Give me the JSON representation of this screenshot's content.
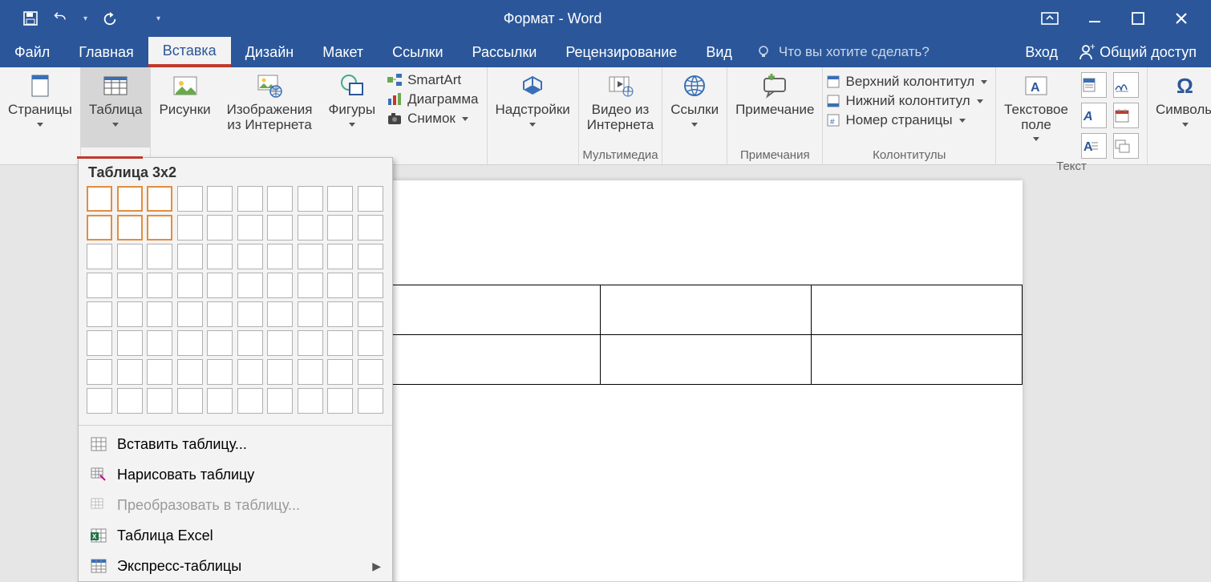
{
  "titlebar": {
    "title": "Формат - Word"
  },
  "tabs": {
    "items": [
      "Файл",
      "Главная",
      "Вставка",
      "Дизайн",
      "Макет",
      "Ссылки",
      "Рассылки",
      "Рецензирование",
      "Вид"
    ],
    "active_index": 2,
    "tellme_placeholder": "Что вы хотите сделать?",
    "signin": "Вход",
    "share": "Общий доступ"
  },
  "ribbon": {
    "pages": {
      "label": "Страницы"
    },
    "table": {
      "label": "Таблица"
    },
    "pics": {
      "label": "Рисунки"
    },
    "netpics": {
      "label": "Изображения из Интернета"
    },
    "shapes": {
      "label": "Фигуры"
    },
    "smartart": "SmartArt",
    "chart": "Диаграмма",
    "screenshot": "Снимок",
    "addins": {
      "label": "Надстройки"
    },
    "video": {
      "label": "Видео из Интернета",
      "caption": "Мультимедиа"
    },
    "links": {
      "label": "Ссылки"
    },
    "comment": {
      "label": "Примечание",
      "caption": "Примечания"
    },
    "header": "Верхний колонтитул",
    "footer": "Нижний колонтитул",
    "pagenum": "Номер страницы",
    "hf_caption": "Колонтитулы",
    "textbox": {
      "label": "Текстовое поле"
    },
    "text_caption": "Текст",
    "symbols": {
      "label": "Символы"
    }
  },
  "menu": {
    "title": "Таблица 3x2",
    "sel_cols": 3,
    "sel_rows": 2,
    "items": {
      "insert": "Вставить таблицу...",
      "draw": "Нарисовать таблицу",
      "convert": "Преобразовать в таблицу...",
      "excel": "Таблица Excel",
      "express": "Экспресс-таблицы"
    }
  }
}
